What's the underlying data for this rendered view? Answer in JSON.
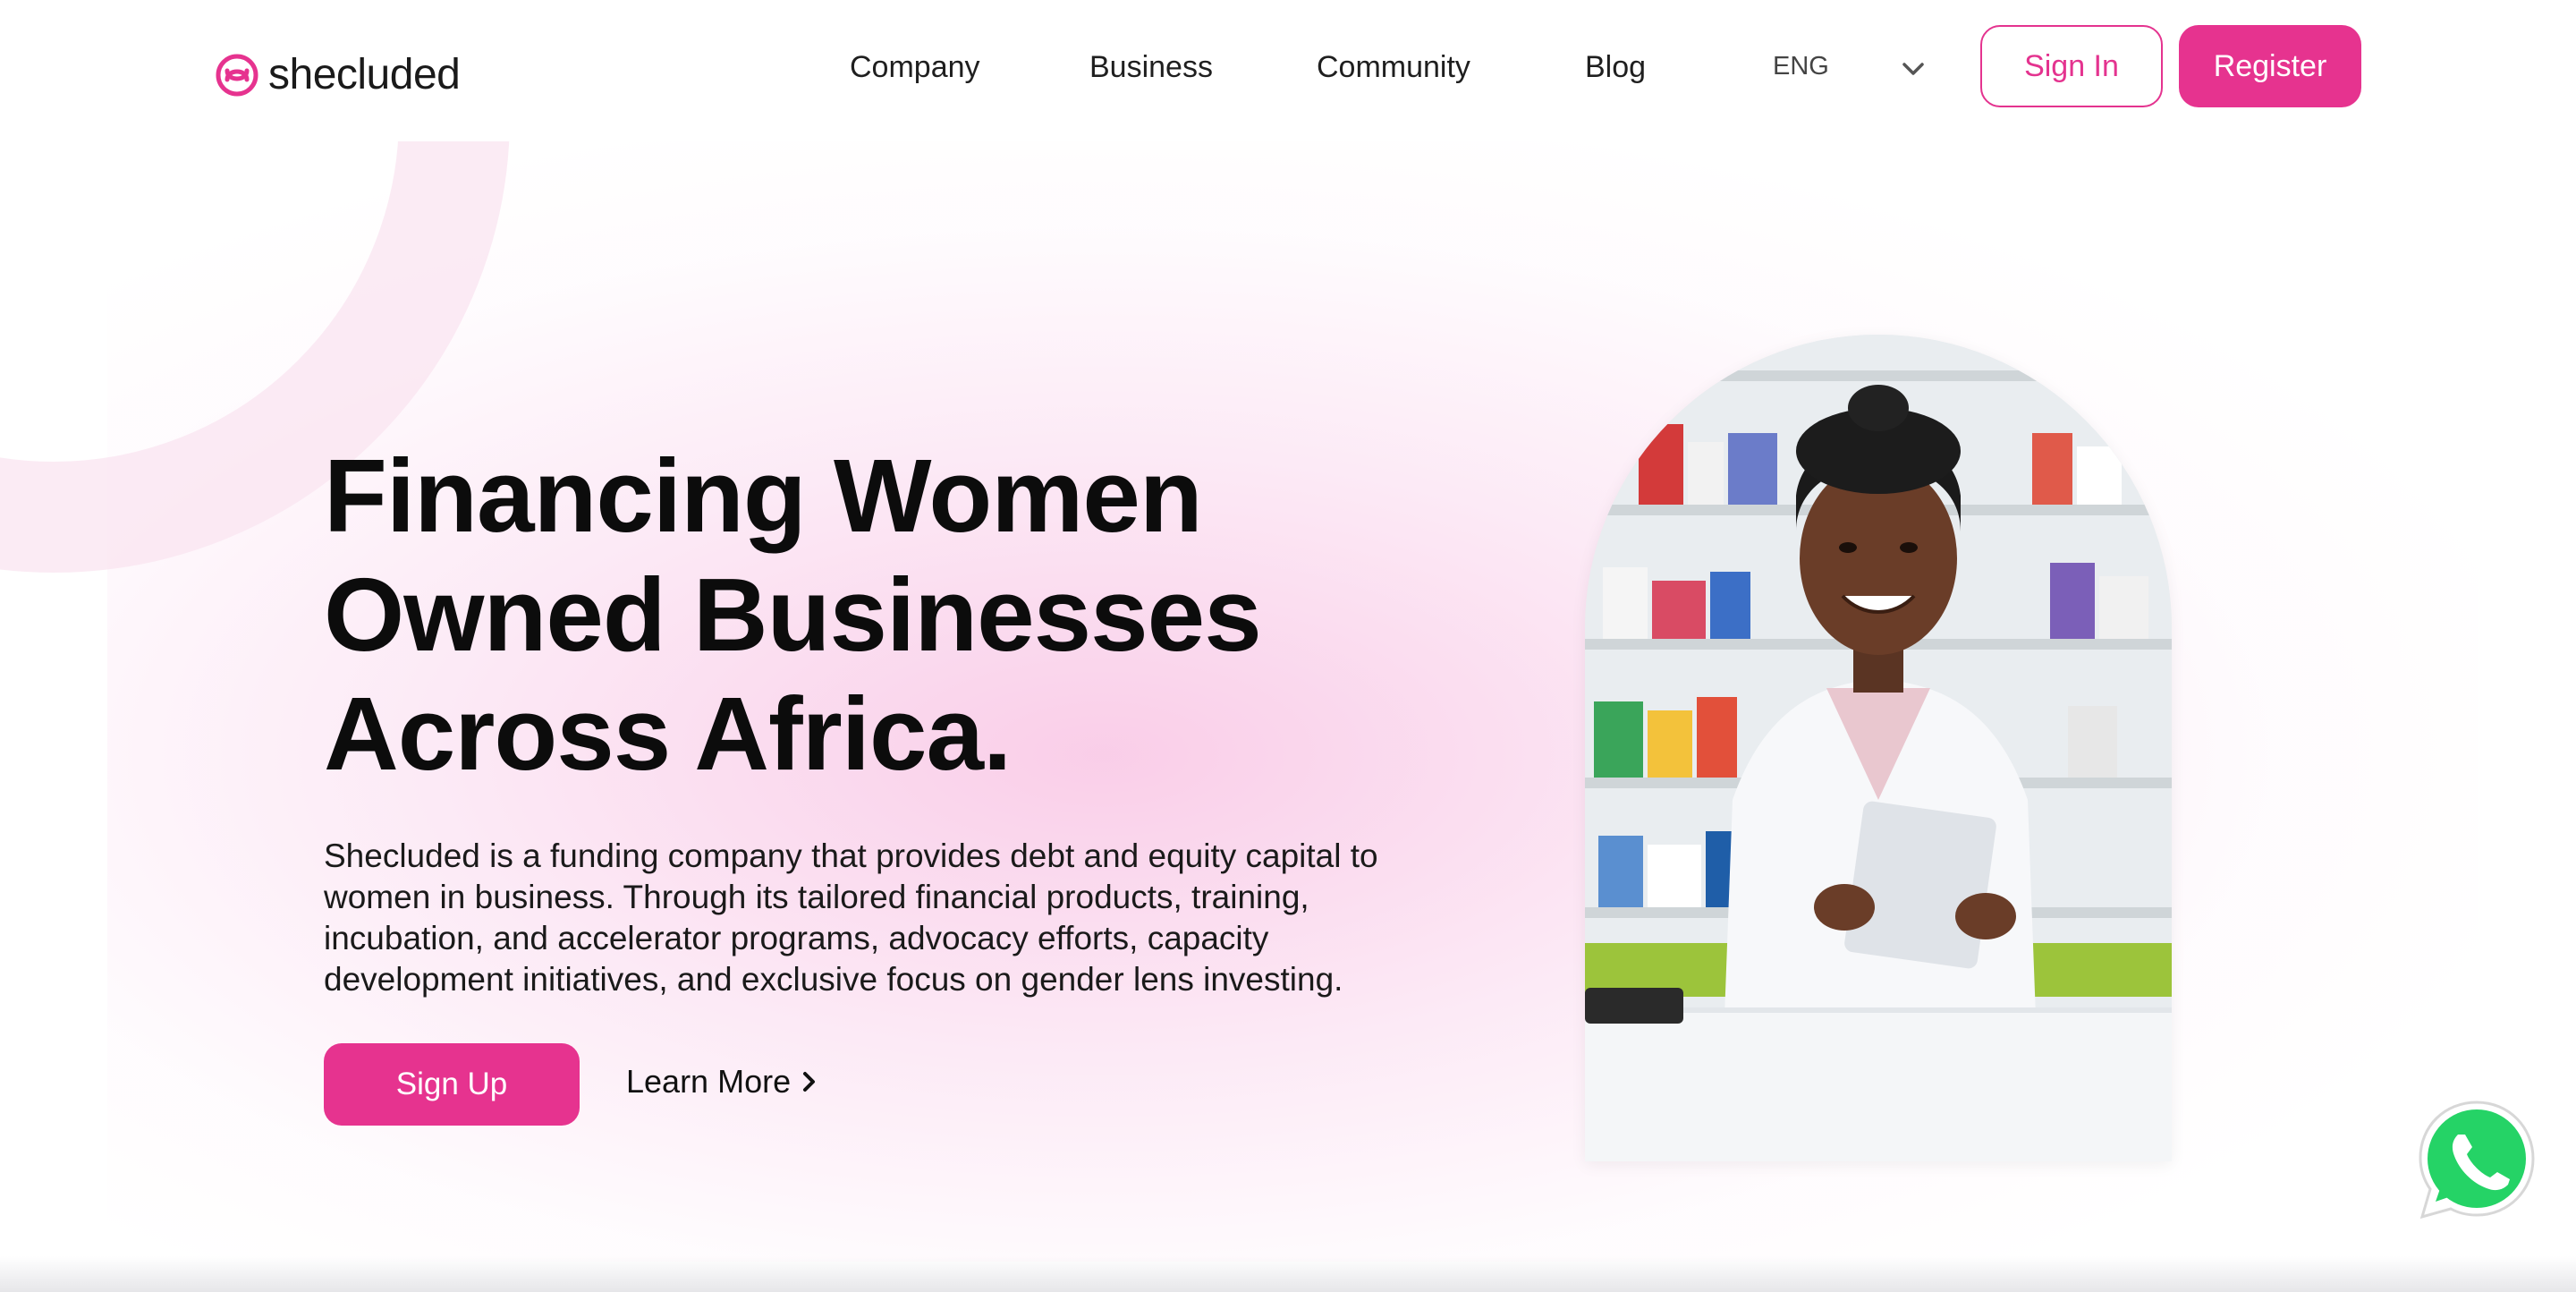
{
  "header": {
    "logo_text": "shecluded",
    "nav": [
      "Company",
      "Business",
      "Community",
      "Blog"
    ],
    "language": "ENG",
    "sign_in_label": "Sign In",
    "register_label": "Register"
  },
  "hero": {
    "title_lines": [
      "Financing Women",
      "Owned Businesses",
      "Across Africa."
    ],
    "description_lines": [
      "Shecluded is a funding company that provides debt and equity capital to",
      "women in business. Through its tailored financial products, training,",
      "incubation, and accelerator programs, advocacy efforts, capacity",
      "development initiatives, and exclusive focus on gender lens investing."
    ],
    "signup_label": "Sign Up",
    "learn_more_label": "Learn More"
  },
  "icons": {
    "logo": "shecluded-logo-icon",
    "language_dropdown": "chevron-down-icon",
    "learn_more_arrow": "chevron-right-icon",
    "chat": "whatsapp-icon"
  },
  "colors": {
    "brand_pink": "#e6338f",
    "text_dark": "#111111",
    "whatsapp_green": "#25d366"
  }
}
